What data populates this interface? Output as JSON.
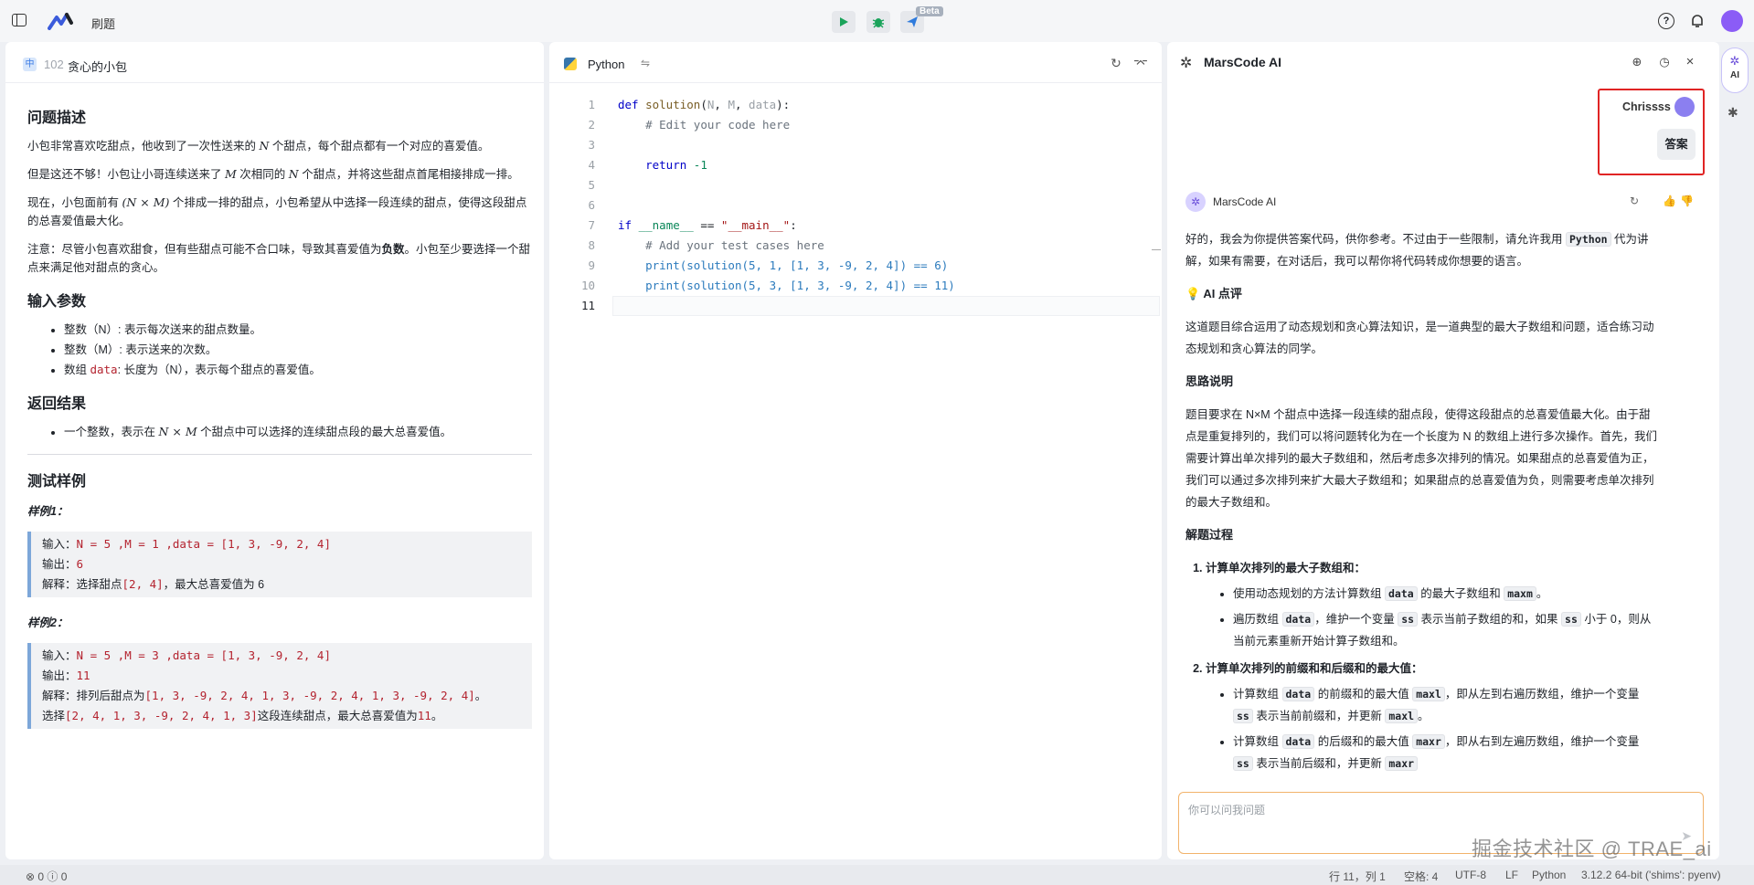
{
  "topbar": {
    "app_name": "刷题",
    "beta_label": "Beta"
  },
  "problem": {
    "tag": "中",
    "number": "102",
    "title": "贪心的小包",
    "desc_heading": "问题描述",
    "p1_a": "小包非常喜欢吃甜点，他收到了一次性送来的",
    "p1_var": "N",
    "p1_b": "个甜点，每个甜点都有一个对应的喜爱值。",
    "p2_a": "但是这还不够！小包让小哥连续送来了",
    "p2_var1": "M",
    "p2_b": "次相同的",
    "p2_var2": "N",
    "p2_c": "个甜点，并将这些甜点首尾相接排成一排。",
    "p3_a": "现在，小包面前有",
    "p3_expr": "(N × M)",
    "p3_b": "个排成一排的甜点，小包希望从中选择一段连续的甜点，使得这段甜点的总喜爱值最大化。",
    "p4_a": "注意：尽管小包喜欢甜食，但有些甜点可能不合口味，导致其喜爱值为",
    "p4_bold": "负数",
    "p4_b": "。小包至少要选择一个甜点来满足他对甜点的贪心。",
    "input_heading": "输入参数",
    "input_items": [
      {
        "pre": "整数（N）: 表示每次送来的甜点数量。"
      },
      {
        "pre": "整数（M）: 表示送来的次数。"
      },
      {
        "pre": "数组 ",
        "code": "data",
        "post": ": 长度为（N），表示每个甜点的喜爱值。"
      }
    ],
    "return_heading": "返回结果",
    "return_a": "一个整数，表示在",
    "return_expr": "N × M",
    "return_b": "个甜点中可以选择的连续甜点段的最大总喜爱值。",
    "tests_heading": "测试样例",
    "ex1_title": "样例1：",
    "ex1_input_label": "输入：",
    "ex1_input": "N = 5 ,M = 1 ,data = [1, 3, -9, 2, 4]",
    "ex1_output_label": "输出：",
    "ex1_output": "6",
    "ex1_explain_label": "解释：选择甜点",
    "ex1_explain_code": "[2, 4]",
    "ex1_explain_post": "，最大总喜爱值为 6",
    "ex2_title": "样例2：",
    "ex2_input_label": "输入：",
    "ex2_input": "N = 5 ,M = 3 ,data = [1, 3, -9, 2, 4]",
    "ex2_output_label": "输出：",
    "ex2_output": "11",
    "ex2_explain_label": "解释：排列后甜点为",
    "ex2_explain_code": "[1, 3, -9, 2, 4, 1, 3, -9, 2, 4, 1, 3, -9, 2, 4]",
    "ex2_explain_post": "。",
    "ex2_choose_pre": "选择",
    "ex2_choose_code": "[2, 4, 1, 3, -9, 2, 4, 1, 3]",
    "ex2_choose_post": "这段连续甜点，最大总喜爱值为",
    "ex2_choose_val": "11",
    "ex2_choose_end": "。"
  },
  "editor": {
    "language": "Python",
    "lines": [
      "1",
      "2",
      "3",
      "4",
      "5",
      "6",
      "7",
      "8",
      "9",
      "10",
      "11"
    ],
    "code": {
      "l1_def": "def",
      "l1_fn": "solution",
      "l1_p1": "N",
      "l1_p2": "M",
      "l1_p3": "data",
      "l2": "# Edit your code here",
      "l4_ret": "return",
      "l4_val": "-1",
      "l7_if": "if",
      "l7_name": "__name__",
      "l7_eq": " == ",
      "l7_str": "\"__main__\"",
      "l8": "# Add your test cases here",
      "l9_print": "print",
      "l9_args": "(solution(5, 1, [1, 3, -9, 2, 4]) == 6)",
      "l10_print": "print",
      "l10_args": "(solution(5, 3, [1, 3, -9, 2, 4]) == 11)"
    }
  },
  "ai": {
    "title": "MarsCode AI",
    "user_name": "Chrissss",
    "user_msg": "答案",
    "bot_name": "MarsCode AI",
    "intro_a": "好的，我会为你提供答案代码，供你参考。不过由于一些限制，请允许我用",
    "intro_code": "Python",
    "intro_b": "代为讲解，如果有需要，在对话后，我可以帮你将代码转成你想要的语言。",
    "review_heading": "💡 AI 点评",
    "review_text": "这道题目综合运用了动态规划和贪心算法知识，是一道典型的最大子数组和问题，适合练习动态规划和贪心算法的同学。",
    "idea_heading": "思路说明",
    "idea_text": "题目要求在 N×M 个甜点中选择一段连续的甜点段，使得这段甜点的总喜爱值最大化。由于甜点是重复排列的，我们可以将问题转化为在一个长度为 N 的数组上进行多次操作。首先，我们需要计算出单次排列的最大子数组和，然后考虑多次排列的情况。如果甜点的总喜爱值为正，我们可以通过多次排列来扩大最大子数组和；如果甜点的总喜爱值为负，则需要考虑单次排列的最大子数组和。",
    "process_heading": "解题过程",
    "step1": "计算单次排列的最大子数组和：",
    "s1a_pre": "使用动态规划的方法计算数组",
    "s1a_c1": "data",
    "s1a_mid": "的最大子数组和",
    "s1a_c2": "maxm",
    "s1a_end": "。",
    "s1b_pre": "遍历数组",
    "s1b_c1": "data",
    "s1b_mid": "，维护一个变量",
    "s1b_c2": "ss",
    "s1b_mid2": "表示当前子数组的和，如果",
    "s1b_c3": "ss",
    "s1b_end": "小于 0，则从当前元素重新开始计算子数组和。",
    "step2": "计算单次排列的前缀和和后缀和的最大值：",
    "s2a_pre": "计算数组",
    "s2a_c1": "data",
    "s2a_mid": "的前缀和的最大值",
    "s2a_c2": "maxl",
    "s2a_mid2": "，即从左到右遍历数组，维护一个变量",
    "s2a_c3": "ss",
    "s2a_mid3": "表示当前前缀和，并更新",
    "s2a_c4": "maxl",
    "s2a_end": "。",
    "s2b_pre": "计算数组",
    "s2b_c1": "data",
    "s2b_mid": "的后缀和的最大值",
    "s2b_c2": "maxr",
    "s2b_mid2": "，即从右到左遍历数组，维护一个变量",
    "s2b_c3": "ss",
    "s2b_mid3": "表示当前后缀和，并更新",
    "s2b_c4": "maxr",
    "s2b_end": "",
    "input_placeholder": "你可以问我问题"
  },
  "rail": {
    "ai_label": "AI"
  },
  "statusbar": {
    "errors": "0",
    "warnings": "0",
    "position": "行 11，列 1",
    "spaces": "空格: 4",
    "encoding": "UTF-8",
    "eol": "LF",
    "language": "Python",
    "interpreter": "3.12.2 64-bit ('shims': pyenv)"
  },
  "watermark": "掘金技术社区 @ TRAE_ai",
  "colors": {
    "accent": "#e02424",
    "run": "#1aa35a",
    "brand": "#3b5bdb"
  }
}
